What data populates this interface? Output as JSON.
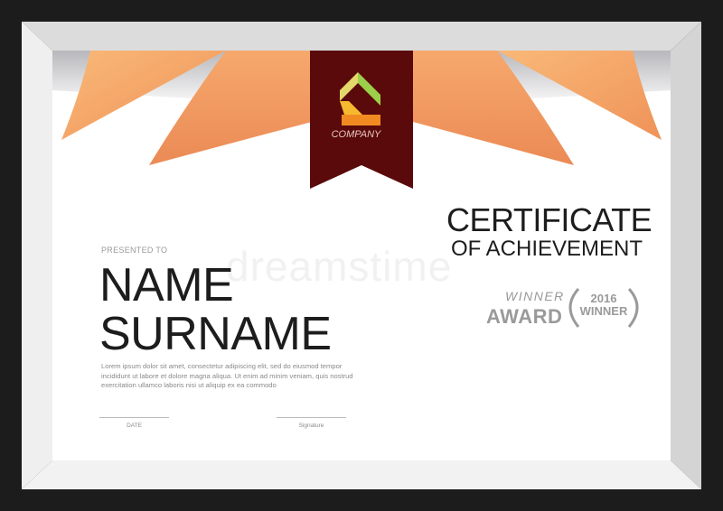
{
  "company": "COMPANY",
  "title_line1": "CERTIFICATE",
  "title_line2": "OF ACHIEVEMENT",
  "presented_to": "PRESENTED TO",
  "name_line1": "NAME",
  "name_line2": "SURNAME",
  "body_text": "Lorem ipsum dolor sit amet, consectetur adipiscing elit, sed do eiusmod tempor incididunt ut labore et dolore magna aliqua. Ut enim ad minim veniam, quis nostrud exercitation ullamco laboris nisi ut aliquip ex ea commodo",
  "date_label": "DATE",
  "signature_label": "Signature",
  "award_winner": "WINNER",
  "award_label": "AWARD",
  "badge_year": "2016",
  "badge_text": "WINNER",
  "watermark": "dreamstime",
  "colors": {
    "ribbon": "#5a0a0a",
    "orange_light": "#f7b06a",
    "orange_dark": "#ee8a50",
    "frame": "#e6e6e6",
    "text": "#1d1d1d"
  }
}
